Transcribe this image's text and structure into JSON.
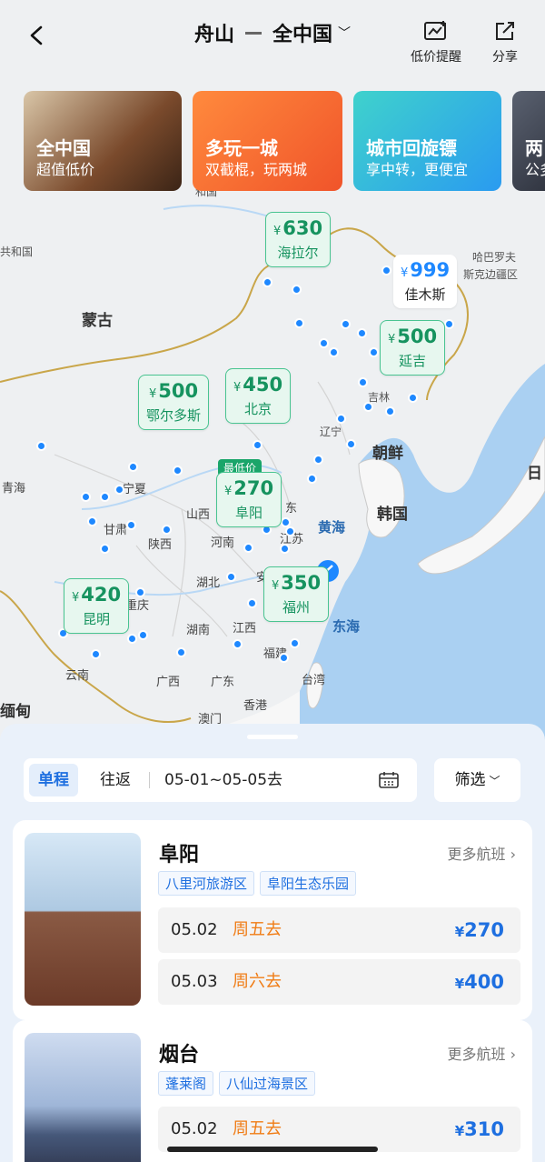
{
  "header": {
    "origin": "舟山",
    "destination": "全中国",
    "actions": [
      {
        "label": "低价提醒",
        "icon": "price-alert-icon"
      },
      {
        "label": "分享",
        "icon": "share-icon"
      }
    ]
  },
  "promos": [
    {
      "title": "全中国",
      "subtitle": "超值低价"
    },
    {
      "title": "多玩一城",
      "subtitle": "双截棍，玩两城"
    },
    {
      "title": "城市回旋镖",
      "subtitle": "享中转，更便宜"
    },
    {
      "title": "两",
      "subtitle": "公多"
    }
  ],
  "map": {
    "places": {
      "mongolia": "蒙古",
      "harbin_khab": "哈巴罗夫",
      "khab2": "斯克边疆区",
      "republic": "共和国",
      "republic2": "和国",
      "liaoning": "辽宁",
      "jilin": "吉林",
      "korea_n": "朝鲜",
      "korea_s": "韩国",
      "japan": "日",
      "qinghai": "青海",
      "ningxia": "宁夏",
      "gansu": "甘肃",
      "shaanxi": "陕西",
      "shanxi": "山西",
      "henan": "河南",
      "hubei": "湖北",
      "hunan": "湖南",
      "jiangxi": "江西",
      "fujian": "福建",
      "guangxi": "广西",
      "guangdong": "广东",
      "yunnan": "云南",
      "chongqing": "重庆",
      "shandong": "东",
      "jiangsu": "江苏",
      "anhui": "安",
      "taiwan": "台湾",
      "hongkong": "香港",
      "macau": "澳门",
      "myanmar": "缅甸",
      "huanghai": "黄海",
      "donghai": "东海",
      "beijing_lbl": "北京"
    },
    "pins": [
      {
        "price": "630",
        "city": "海拉尔"
      },
      {
        "price": "999",
        "city": "佳木斯"
      },
      {
        "price": "500",
        "city": "延吉"
      },
      {
        "price": "450",
        "city": "北京"
      },
      {
        "price": "500",
        "city": "鄂尔多斯"
      },
      {
        "price": "270",
        "city": "阜阳",
        "tag": "最低价"
      },
      {
        "price": "350",
        "city": "福州"
      },
      {
        "price": "420",
        "city": "昆明"
      }
    ],
    "currency": "¥"
  },
  "search": {
    "one_way": "单程",
    "round_trip": "往返",
    "dates": "05-01~05-05去",
    "filter": "筛选"
  },
  "results": [
    {
      "city": "阜阳",
      "more": "更多航班",
      "tags": [
        "八里河旅游区",
        "阜阳生态乐园"
      ],
      "flights": [
        {
          "date": "05.02",
          "weekday": "周五去",
          "price": "270"
        },
        {
          "date": "05.03",
          "weekday": "周六去",
          "price": "400"
        }
      ]
    },
    {
      "city": "烟台",
      "more": "更多航班",
      "tags": [
        "蓬莱阁",
        "八仙过海景区"
      ],
      "flights": [
        {
          "date": "05.02",
          "weekday": "周五去",
          "price": "310"
        }
      ]
    }
  ]
}
